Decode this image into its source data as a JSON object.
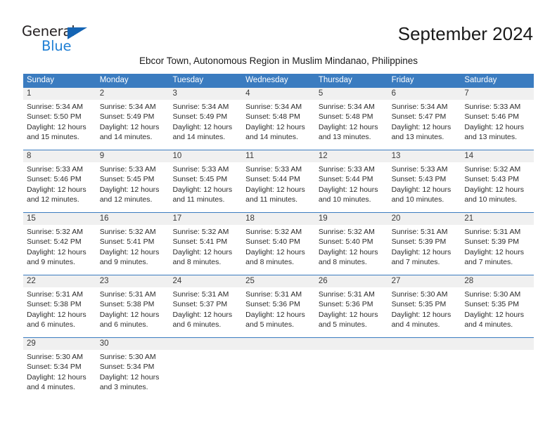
{
  "brand": {
    "name_top": "General",
    "name_bottom": "Blue",
    "triangle_color": "#1464b4",
    "blue_color": "#1f7fd4"
  },
  "header": {
    "title": "September 2024",
    "subtitle": "Ebcor Town, Autonomous Region in Muslim Mindanao, Philippines"
  },
  "theme": {
    "header_bg": "#3b7cc0",
    "daynum_bg": "#f0f0f0",
    "text": "#2b2b2b"
  },
  "weekdays": [
    "Sunday",
    "Monday",
    "Tuesday",
    "Wednesday",
    "Thursday",
    "Friday",
    "Saturday"
  ],
  "weeks": [
    {
      "days": [
        {
          "num": "1",
          "l1": "Sunrise: 5:34 AM",
          "l2": "Sunset: 5:50 PM",
          "l3": "Daylight: 12 hours",
          "l4": "and 15 minutes."
        },
        {
          "num": "2",
          "l1": "Sunrise: 5:34 AM",
          "l2": "Sunset: 5:49 PM",
          "l3": "Daylight: 12 hours",
          "l4": "and 14 minutes."
        },
        {
          "num": "3",
          "l1": "Sunrise: 5:34 AM",
          "l2": "Sunset: 5:49 PM",
          "l3": "Daylight: 12 hours",
          "l4": "and 14 minutes."
        },
        {
          "num": "4",
          "l1": "Sunrise: 5:34 AM",
          "l2": "Sunset: 5:48 PM",
          "l3": "Daylight: 12 hours",
          "l4": "and 14 minutes."
        },
        {
          "num": "5",
          "l1": "Sunrise: 5:34 AM",
          "l2": "Sunset: 5:48 PM",
          "l3": "Daylight: 12 hours",
          "l4": "and 13 minutes."
        },
        {
          "num": "6",
          "l1": "Sunrise: 5:34 AM",
          "l2": "Sunset: 5:47 PM",
          "l3": "Daylight: 12 hours",
          "l4": "and 13 minutes."
        },
        {
          "num": "7",
          "l1": "Sunrise: 5:33 AM",
          "l2": "Sunset: 5:46 PM",
          "l3": "Daylight: 12 hours",
          "l4": "and 13 minutes."
        }
      ]
    },
    {
      "days": [
        {
          "num": "8",
          "l1": "Sunrise: 5:33 AM",
          "l2": "Sunset: 5:46 PM",
          "l3": "Daylight: 12 hours",
          "l4": "and 12 minutes."
        },
        {
          "num": "9",
          "l1": "Sunrise: 5:33 AM",
          "l2": "Sunset: 5:45 PM",
          "l3": "Daylight: 12 hours",
          "l4": "and 12 minutes."
        },
        {
          "num": "10",
          "l1": "Sunrise: 5:33 AM",
          "l2": "Sunset: 5:45 PM",
          "l3": "Daylight: 12 hours",
          "l4": "and 11 minutes."
        },
        {
          "num": "11",
          "l1": "Sunrise: 5:33 AM",
          "l2": "Sunset: 5:44 PM",
          "l3": "Daylight: 12 hours",
          "l4": "and 11 minutes."
        },
        {
          "num": "12",
          "l1": "Sunrise: 5:33 AM",
          "l2": "Sunset: 5:44 PM",
          "l3": "Daylight: 12 hours",
          "l4": "and 10 minutes."
        },
        {
          "num": "13",
          "l1": "Sunrise: 5:33 AM",
          "l2": "Sunset: 5:43 PM",
          "l3": "Daylight: 12 hours",
          "l4": "and 10 minutes."
        },
        {
          "num": "14",
          "l1": "Sunrise: 5:32 AM",
          "l2": "Sunset: 5:43 PM",
          "l3": "Daylight: 12 hours",
          "l4": "and 10 minutes."
        }
      ]
    },
    {
      "days": [
        {
          "num": "15",
          "l1": "Sunrise: 5:32 AM",
          "l2": "Sunset: 5:42 PM",
          "l3": "Daylight: 12 hours",
          "l4": "and 9 minutes."
        },
        {
          "num": "16",
          "l1": "Sunrise: 5:32 AM",
          "l2": "Sunset: 5:41 PM",
          "l3": "Daylight: 12 hours",
          "l4": "and 9 minutes."
        },
        {
          "num": "17",
          "l1": "Sunrise: 5:32 AM",
          "l2": "Sunset: 5:41 PM",
          "l3": "Daylight: 12 hours",
          "l4": "and 8 minutes."
        },
        {
          "num": "18",
          "l1": "Sunrise: 5:32 AM",
          "l2": "Sunset: 5:40 PM",
          "l3": "Daylight: 12 hours",
          "l4": "and 8 minutes."
        },
        {
          "num": "19",
          "l1": "Sunrise: 5:32 AM",
          "l2": "Sunset: 5:40 PM",
          "l3": "Daylight: 12 hours",
          "l4": "and 8 minutes."
        },
        {
          "num": "20",
          "l1": "Sunrise: 5:31 AM",
          "l2": "Sunset: 5:39 PM",
          "l3": "Daylight: 12 hours",
          "l4": "and 7 minutes."
        },
        {
          "num": "21",
          "l1": "Sunrise: 5:31 AM",
          "l2": "Sunset: 5:39 PM",
          "l3": "Daylight: 12 hours",
          "l4": "and 7 minutes."
        }
      ]
    },
    {
      "days": [
        {
          "num": "22",
          "l1": "Sunrise: 5:31 AM",
          "l2": "Sunset: 5:38 PM",
          "l3": "Daylight: 12 hours",
          "l4": "and 6 minutes."
        },
        {
          "num": "23",
          "l1": "Sunrise: 5:31 AM",
          "l2": "Sunset: 5:38 PM",
          "l3": "Daylight: 12 hours",
          "l4": "and 6 minutes."
        },
        {
          "num": "24",
          "l1": "Sunrise: 5:31 AM",
          "l2": "Sunset: 5:37 PM",
          "l3": "Daylight: 12 hours",
          "l4": "and 6 minutes."
        },
        {
          "num": "25",
          "l1": "Sunrise: 5:31 AM",
          "l2": "Sunset: 5:36 PM",
          "l3": "Daylight: 12 hours",
          "l4": "and 5 minutes."
        },
        {
          "num": "26",
          "l1": "Sunrise: 5:31 AM",
          "l2": "Sunset: 5:36 PM",
          "l3": "Daylight: 12 hours",
          "l4": "and 5 minutes."
        },
        {
          "num": "27",
          "l1": "Sunrise: 5:30 AM",
          "l2": "Sunset: 5:35 PM",
          "l3": "Daylight: 12 hours",
          "l4": "and 4 minutes."
        },
        {
          "num": "28",
          "l1": "Sunrise: 5:30 AM",
          "l2": "Sunset: 5:35 PM",
          "l3": "Daylight: 12 hours",
          "l4": "and 4 minutes."
        }
      ]
    },
    {
      "days": [
        {
          "num": "29",
          "l1": "Sunrise: 5:30 AM",
          "l2": "Sunset: 5:34 PM",
          "l3": "Daylight: 12 hours",
          "l4": "and 4 minutes."
        },
        {
          "num": "30",
          "l1": "Sunrise: 5:30 AM",
          "l2": "Sunset: 5:34 PM",
          "l3": "Daylight: 12 hours",
          "l4": "and 3 minutes."
        },
        {
          "num": "",
          "l1": "",
          "l2": "",
          "l3": "",
          "l4": ""
        },
        {
          "num": "",
          "l1": "",
          "l2": "",
          "l3": "",
          "l4": ""
        },
        {
          "num": "",
          "l1": "",
          "l2": "",
          "l3": "",
          "l4": ""
        },
        {
          "num": "",
          "l1": "",
          "l2": "",
          "l3": "",
          "l4": ""
        },
        {
          "num": "",
          "l1": "",
          "l2": "",
          "l3": "",
          "l4": ""
        }
      ]
    }
  ]
}
